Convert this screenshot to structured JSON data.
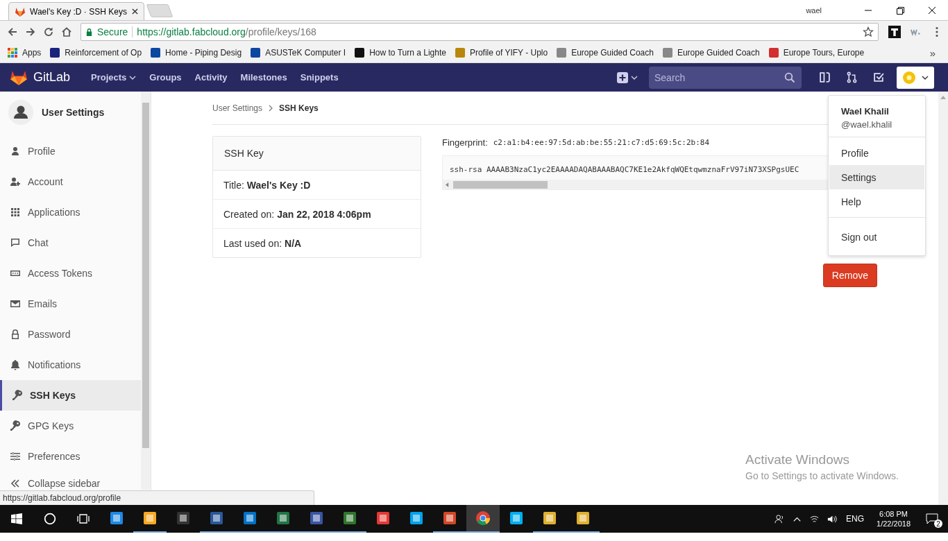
{
  "browser": {
    "tabs": [
      {
        "title": "Wael's Key :D · SSH Keys",
        "selected": true
      }
    ],
    "profile_name": "wael",
    "address": {
      "security": "Secure",
      "host": "https://gitlab.fabcloud.org",
      "path": "/profile/keys/168"
    },
    "bookmarks": [
      {
        "label": "Apps"
      },
      {
        "label": "Reinforcement of Op"
      },
      {
        "label": "Home - Piping Desig"
      },
      {
        "label": "ASUSTeK Computer I"
      },
      {
        "label": "How to Turn a Lighte"
      },
      {
        "label": "Profile of YIFY - Uplo"
      },
      {
        "label": "Europe Guided Coach"
      },
      {
        "label": "Europe Guided Coach"
      },
      {
        "label": "Europe Tours, Europe"
      }
    ],
    "bookmarks_overflow": "»"
  },
  "gitlab_nav": {
    "logo": "GitLab",
    "links": [
      {
        "label": "Projects",
        "dropdown": true
      },
      {
        "label": "Groups",
        "dropdown": false
      },
      {
        "label": "Activity",
        "dropdown": false
      },
      {
        "label": "Milestones",
        "dropdown": false
      },
      {
        "label": "Snippets",
        "dropdown": false
      }
    ],
    "search": {
      "placeholder": "Search"
    }
  },
  "sidebar": {
    "title": "User Settings",
    "items": [
      {
        "label": "Profile",
        "selected": false
      },
      {
        "label": "Account",
        "selected": false
      },
      {
        "label": "Applications",
        "selected": false
      },
      {
        "label": "Chat",
        "selected": false
      },
      {
        "label": "Access Tokens",
        "selected": false
      },
      {
        "label": "Emails",
        "selected": false
      },
      {
        "label": "Password",
        "selected": false
      },
      {
        "label": "Notifications",
        "selected": false
      },
      {
        "label": "SSH Keys",
        "selected": true
      },
      {
        "label": "GPG Keys",
        "selected": false
      },
      {
        "label": "Preferences",
        "selected": false
      }
    ],
    "collapse": "Collapse sidebar"
  },
  "breadcrumb": [
    "User Settings",
    "SSH Keys"
  ],
  "key_card": {
    "header": "SSH Key",
    "rows": [
      {
        "label": "Title:",
        "value": "Wael's Key :D"
      },
      {
        "label": "Created on:",
        "value": "Jan 22, 2018 4:06pm"
      },
      {
        "label": "Last used on:",
        "value": "N/A"
      }
    ]
  },
  "fingerprint": {
    "label": "Fingerprint:",
    "value": "c2:a1:b4:ee:97:5d:ab:be:55:21:c7:d5:69:5c:2b:84"
  },
  "public_key": "ssh-rsa AAAAB3NzaC1yc2EAAAADAQABAAABAQC7KE1e2AkfqWQEtqwmznaFrV97iN73XSPgsUEC",
  "remove_button": "Remove",
  "user_menu": {
    "name": "Wael Khalil",
    "handle": "@wael.khalil",
    "sections": [
      {
        "items": [
          {
            "label": "Profile",
            "selected": false
          },
          {
            "label": "Settings",
            "selected": true
          },
          {
            "label": "Help",
            "selected": false
          }
        ]
      },
      {
        "items": [
          {
            "label": "Sign out",
            "selected": false
          }
        ]
      }
    ]
  },
  "status_url": "https://gitlab.fabcloud.org/profile",
  "activation_notice": {
    "title": "Activate Windows",
    "text": "Go to Settings to activate Windows."
  },
  "taskbar": {
    "apps": [
      {
        "running": false,
        "selected": false
      },
      {
        "running": true,
        "selected": false
      },
      {
        "running": false,
        "selected": false
      },
      {
        "running": true,
        "selected": false
      },
      {
        "running": true,
        "selected": false
      },
      {
        "running": true,
        "selected": false
      },
      {
        "running": true,
        "selected": false
      },
      {
        "running": true,
        "selected": false
      },
      {
        "running": false,
        "selected": false
      },
      {
        "running": false,
        "selected": false
      },
      {
        "running": true,
        "selected": false
      },
      {
        "running": true,
        "selected": true
      },
      {
        "running": false,
        "selected": false
      },
      {
        "running": true,
        "selected": false
      },
      {
        "running": true,
        "selected": false
      }
    ],
    "language": "ENG",
    "time": "6:08 PM",
    "date": "1/22/2018",
    "notifications": "2"
  }
}
